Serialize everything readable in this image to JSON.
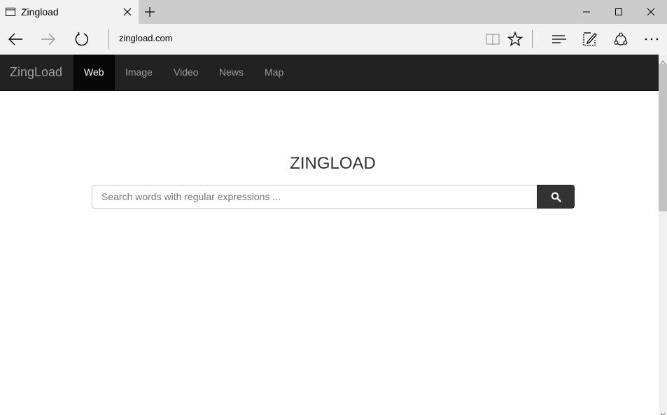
{
  "tab": {
    "title": "Zingload",
    "favicon": "page-icon",
    "close_icon": "close-icon"
  },
  "window_controls": [
    "minimize-icon",
    "maximize-icon",
    "close-icon"
  ],
  "toolbar": {
    "address": "zingload.com",
    "icons": [
      "back-arrow-icon",
      "forward-arrow-icon",
      "refresh-icon",
      "reading-view-icon",
      "star-icon",
      "hub-icon",
      "web-note-icon",
      "share-icon",
      "more-icon"
    ]
  },
  "site": {
    "brand": "ZingLoad",
    "nav": [
      {
        "label": "Web",
        "active": true
      },
      {
        "label": "Image",
        "active": false
      },
      {
        "label": "Video",
        "active": false
      },
      {
        "label": "News",
        "active": false
      },
      {
        "label": "Map",
        "active": false
      }
    ],
    "title": "ZINGLOAD",
    "search_placeholder": "Search words with regular expressions ...",
    "search_icon": "magnifier-icon"
  },
  "colors": {
    "navbar": "#222222",
    "nav_active": "#080808",
    "search_button": "#333333"
  }
}
